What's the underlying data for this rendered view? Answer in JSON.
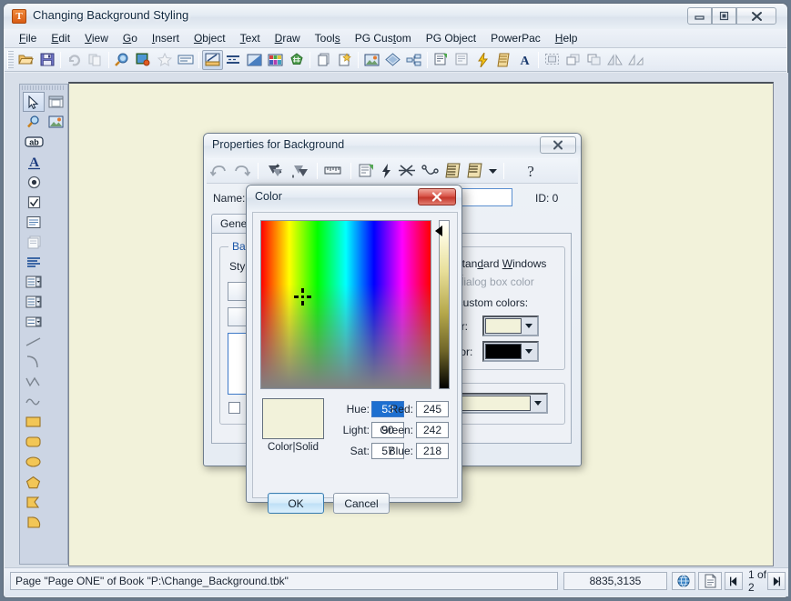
{
  "window": {
    "title": "Changing Background Styling",
    "icon": "toolbook-icon",
    "minimize_label": "minimize-icon",
    "maximize_label": "maximize-icon",
    "close_label": "close-icon"
  },
  "menubar": {
    "items": [
      {
        "label": "File",
        "accel": "F"
      },
      {
        "label": "Edit",
        "accel": "E"
      },
      {
        "label": "View",
        "accel": "V"
      },
      {
        "label": "Go",
        "accel": "G"
      },
      {
        "label": "Insert",
        "accel": "I"
      },
      {
        "label": "Object",
        "accel": "O"
      },
      {
        "label": "Text",
        "accel": "T"
      },
      {
        "label": "Draw",
        "accel": "D"
      },
      {
        "label": "Tools",
        "accel": "s"
      },
      {
        "label": "PG Custom",
        "accel": "t"
      },
      {
        "label": "PG Object",
        "accel": ""
      },
      {
        "label": "PowerPac",
        "accel": ""
      },
      {
        "label": "Help",
        "accel": "H"
      }
    ]
  },
  "toolbar": {
    "buttons": [
      "open-folder-icon",
      "save-disk-icon",
      "sep",
      "undo-circular-icon",
      "copy-pages-icon",
      "sep",
      "preview-magnifier-icon",
      "run-globe-icon",
      "favorites-star-icon",
      "form-field-icon",
      "sep",
      "author-mode-icon",
      "align-lines-icon",
      "gradient-fill-icon",
      "color-palette-icon",
      "hash-green-icon",
      "sep",
      "new-page-icon",
      "new-background-icon",
      "sep",
      "image-icon",
      "diamond-shape-icon",
      "group-hierarchy-icon",
      "sep",
      "properties-icon",
      "page-properties-icon",
      "script-lightning-icon",
      "script-scroll-icon",
      "text-style-icon",
      "sep",
      "select-area-icon",
      "bring-front-icon",
      "send-back-icon",
      "flip-horizontal-icon",
      "flip-vertical-icon"
    ]
  },
  "palette": {
    "tools": [
      [
        "arrow-select-icon",
        "window-frame-icon"
      ],
      [
        "magnifier-zoom-icon",
        "image-tool-icon"
      ],
      [
        "text-field-ab-icon"
      ],
      [
        "rich-text-a-icon"
      ],
      [
        "radio-button-icon"
      ],
      [
        "checkbox-tool-icon"
      ],
      [
        "single-line-field-icon"
      ],
      [
        "stacked-fields-icon"
      ],
      [
        "paragraph-text-icon"
      ],
      [
        "combobox-tool-icon"
      ],
      [
        "listbox-tool-icon"
      ],
      [
        "dropdown-tool-icon"
      ],
      [
        "line-tool-icon"
      ],
      [
        "arc-tool-icon"
      ],
      [
        "polyline-tool-icon"
      ],
      [
        "curve-tool-icon"
      ],
      [
        "rectangle-tool-icon"
      ],
      [
        "rounded-rectangle-tool-icon"
      ],
      [
        "ellipse-tool-icon"
      ],
      [
        "polygon-tool-icon"
      ],
      [
        "irregular-polygon-tool-icon"
      ],
      [
        "pie-shape-tool-icon"
      ]
    ]
  },
  "canvas": {
    "background_color": "#f2f2da"
  },
  "statusbar": {
    "page_text": "Page \"Page ONE\" of Book \"P:\\Change_Background.tbk\"",
    "coordinates": "8835,3135",
    "globe_icon": "reader-globe-icon",
    "doc_icon": "page-doc-icon",
    "prev_icon": "previous-page-icon",
    "page_count": "1 of 2",
    "next_icon": "next-page-icon"
  },
  "properties_dialog": {
    "title": "Properties for Background",
    "close_label": "close-icon",
    "toolbar": [
      "undo-icon",
      "redo-icon",
      "sep",
      "bring-closer-icon",
      "send-farther-icon",
      "sep",
      "ruler-icon",
      "sep",
      "object-properties-icon",
      "quick-script-icon",
      "cut-link-icon",
      "path-node-icon",
      "script-editor-icon",
      "script-list-icon",
      "sep",
      "help-question-icon"
    ],
    "name_label": "Name:",
    "name_value": "",
    "id_label": "ID: 0",
    "tabs": [
      {
        "label": "General",
        "active": true
      }
    ],
    "background_group": {
      "legend": "Background",
      "style_label": "Style:",
      "style_value": "",
      "fill_value": "",
      "preview_value": "",
      "checkbox_label": "",
      "checkbox_checked": false
    },
    "windows_colors_group": {
      "legend": "",
      "radio_standard": "Use standard Windows colors",
      "radio_dialog": "Use dialog box color",
      "radio_custom": "Use custom colors:",
      "fill_color_label": "Fill color:",
      "fill_color_value": "#f2f2da",
      "line_color_label": "Line color:",
      "line_color_value": "#000000",
      "selected": "custom"
    },
    "page_group": {
      "legend": "",
      "color_value": "#f2f2da"
    }
  },
  "color_dialog": {
    "title": "Color",
    "close_label": "close-icon",
    "spectrum_name": "color-spectrum",
    "luminance_name": "luminance-bar",
    "preview_label": "Color|Solid",
    "preview_color": "#f2f2da",
    "fields": [
      {
        "label": "Hue:",
        "value": "53",
        "selected": true
      },
      {
        "label": "Light:",
        "value": "90",
        "selected": false
      },
      {
        "label": "Sat:",
        "value": "57",
        "selected": false
      },
      {
        "label": "Red:",
        "value": "245",
        "selected": false
      },
      {
        "label": "Green:",
        "value": "242",
        "selected": false
      },
      {
        "label": "Blue:",
        "value": "218",
        "selected": false
      }
    ],
    "ok_label": "OK",
    "cancel_label": "Cancel"
  }
}
